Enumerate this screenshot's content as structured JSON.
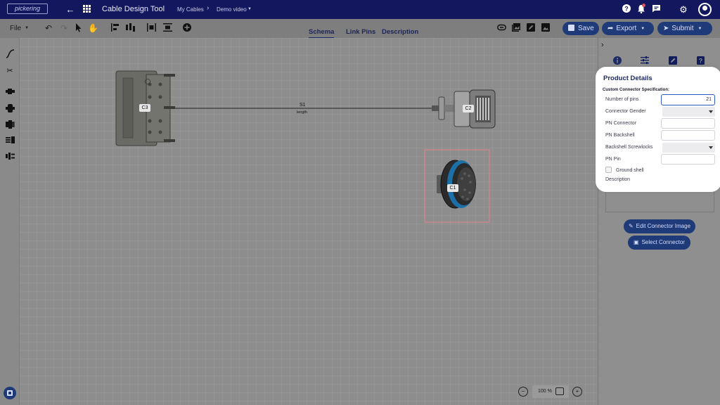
{
  "app": {
    "logo_text": "pickering",
    "title": "Cable Design Tool",
    "breadcrumb": [
      "My Cables",
      "Demo video"
    ],
    "breadcrumb_separator": "›"
  },
  "toolbar": {
    "file_label": "File",
    "tabs": [
      "Schema",
      "Link Pins",
      "Description"
    ],
    "active_tab": "Schema",
    "save_label": "Save",
    "export_label": "Export",
    "submit_label": "Submit"
  },
  "canvas": {
    "connectors": [
      {
        "id": "C3"
      },
      {
        "id": "C2"
      },
      {
        "id": "C1"
      }
    ],
    "cable": {
      "label": "S1",
      "sublabel": "length"
    }
  },
  "product_details": {
    "title": "Product Details",
    "subtitle": "Custom Connector Specification:",
    "fields": [
      {
        "label": "Number of pins",
        "type": "input",
        "value": "21"
      },
      {
        "label": "Connector Gender",
        "type": "select",
        "value": ""
      },
      {
        "label": "PN Connector",
        "type": "input",
        "value": ""
      },
      {
        "label": "PN Backshell",
        "type": "input",
        "value": ""
      },
      {
        "label": "Backshell Screwlocks",
        "type": "select",
        "value": ""
      },
      {
        "label": "PN Pin",
        "type": "input",
        "value": ""
      }
    ],
    "ground_shell_label": "Ground shell",
    "ground_shell_checked": false,
    "description_label": "Description"
  },
  "right_panel": {
    "edit_image_label": "Edit Connector Image",
    "select_connector_label": "Select Connector"
  },
  "zoom": {
    "level": "100 %"
  },
  "colors": {
    "topbar": "#12175e",
    "accent": "#1f3a78",
    "highlight_border": "#2e5cb8",
    "selection_box": "#c9868b"
  }
}
